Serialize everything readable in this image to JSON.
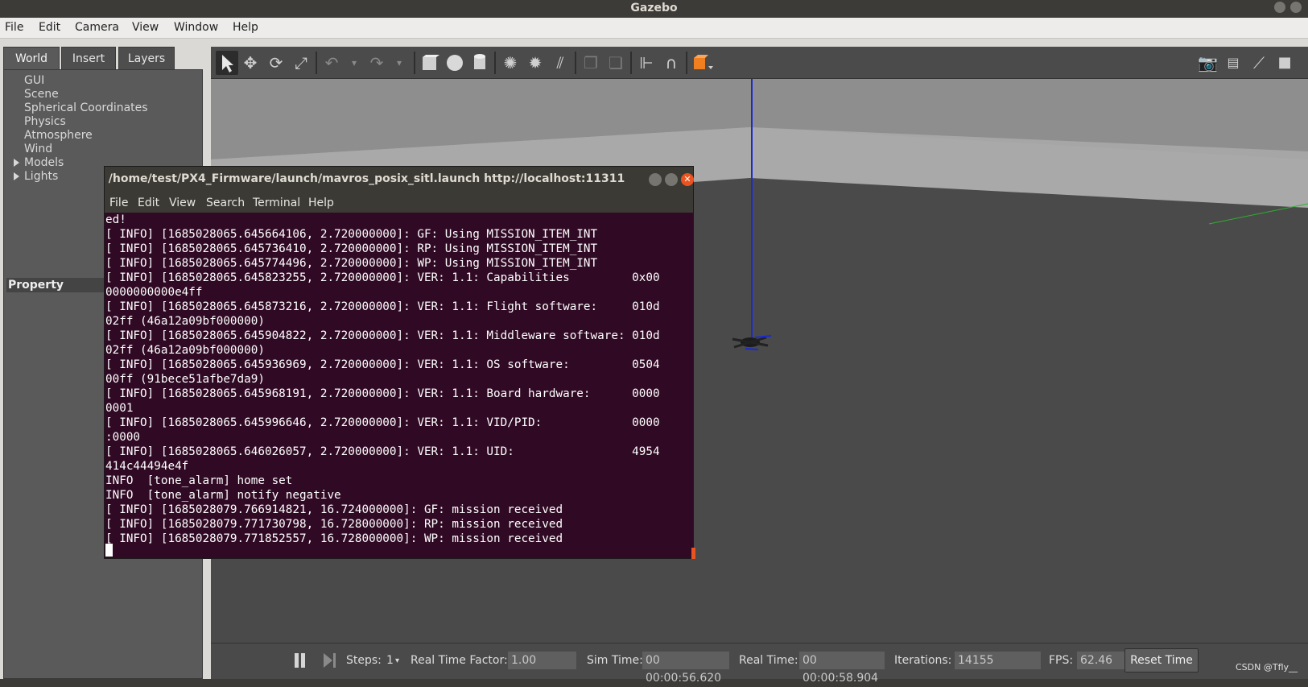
{
  "window": {
    "title": "Gazebo"
  },
  "menubar": {
    "items": [
      "File",
      "Edit",
      "Camera",
      "View",
      "Window",
      "Help"
    ]
  },
  "left_panel": {
    "tabs": [
      "World",
      "Insert",
      "Layers"
    ],
    "tree": [
      "GUI",
      "Scene",
      "Spherical Coordinates",
      "Physics",
      "Atmosphere",
      "Wind",
      "Models",
      "Lights"
    ],
    "property_header": "Property"
  },
  "toolbar": {
    "icons": [
      "select-arrow-icon",
      "translate-icon",
      "rotate-icon",
      "scale-icon",
      "undo-icon",
      "undo-dropdown-icon",
      "redo-icon",
      "redo-dropdown-icon",
      "box-icon",
      "sphere-icon",
      "cylinder-icon",
      "point-light-icon",
      "spot-light-icon",
      "directional-light-icon",
      "copy-icon",
      "paste-icon",
      "align-icon",
      "snap-icon",
      "view-angle-icon",
      "screenshot-icon",
      "log-icon",
      "plot-icon",
      "record-icon"
    ]
  },
  "bottombar": {
    "steps_label": "Steps:",
    "steps_value": "1",
    "rtf_label": "Real Time Factor:",
    "rtf_value": "1.00",
    "sim_time_label": "Sim Time:",
    "sim_time_value": "00 00:00:56.620",
    "real_time_label": "Real Time:",
    "real_time_value": "00 00:00:58.904",
    "iterations_label": "Iterations:",
    "iterations_value": "14155",
    "fps_label": "FPS:",
    "fps_value": "62.46",
    "reset_label": "Reset Time"
  },
  "watermark": "CSDN @Tfly__",
  "terminal": {
    "title": "/home/test/PX4_Firmware/launch/mavros_posix_sitl.launch http://localhost:11311",
    "menu": [
      "File",
      "Edit",
      "View",
      "Search",
      "Terminal",
      "Help"
    ],
    "lines": [
      "ed!",
      "[ INFO] [1685028065.645664106, 2.720000000]: GF: Using MISSION_ITEM_INT",
      "[ INFO] [1685028065.645736410, 2.720000000]: RP: Using MISSION_ITEM_INT",
      "[ INFO] [1685028065.645774496, 2.720000000]: WP: Using MISSION_ITEM_INT",
      "[ INFO] [1685028065.645823255, 2.720000000]: VER: 1.1: Capabilities         0x00",
      "0000000000e4ff",
      "[ INFO] [1685028065.645873216, 2.720000000]: VER: 1.1: Flight software:     010d",
      "02ff (46a12a09bf000000)",
      "[ INFO] [1685028065.645904822, 2.720000000]: VER: 1.1: Middleware software: 010d",
      "02ff (46a12a09bf000000)",
      "[ INFO] [1685028065.645936969, 2.720000000]: VER: 1.1: OS software:         0504",
      "00ff (91bece51afbe7da9)",
      "[ INFO] [1685028065.645968191, 2.720000000]: VER: 1.1: Board hardware:      0000",
      "0001",
      "[ INFO] [1685028065.645996646, 2.720000000]: VER: 1.1: VID/PID:             0000",
      ":0000",
      "[ INFO] [1685028065.646026057, 2.720000000]: VER: 1.1: UID:                 4954",
      "414c44494e4f",
      "INFO  [tone_alarm] home set",
      "INFO  [tone_alarm] notify negative",
      "[ INFO] [1685028079.766914821, 16.724000000]: GF: mission received",
      "[ INFO] [1685028079.771730798, 16.728000000]: RP: mission received",
      "[ INFO] [1685028079.771852557, 16.728000000]: WP: mission received"
    ]
  },
  "colors": {
    "terminal_bg": "#300a24",
    "close_btn": "#e95420",
    "z_axis": "#1a2bd0"
  }
}
